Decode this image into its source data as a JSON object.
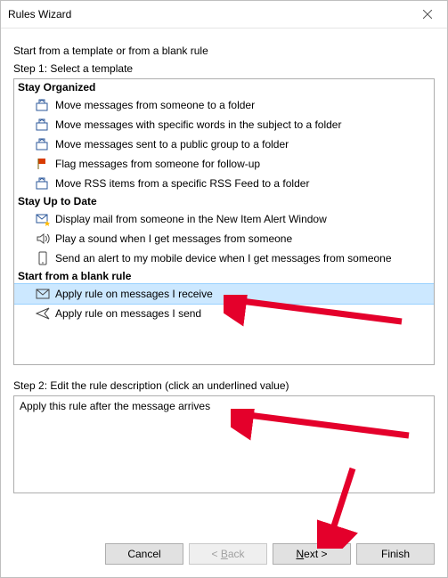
{
  "titlebar": {
    "title": "Rules Wizard"
  },
  "intro": "Start from a template or from a blank rule",
  "step1_label": "Step 1: Select a template",
  "categories": [
    {
      "name": "Stay Organized",
      "items": [
        {
          "icon": "move-folder-icon",
          "label": "Move messages from someone to a folder"
        },
        {
          "icon": "move-folder-icon",
          "label": "Move messages with specific words in the subject to a folder"
        },
        {
          "icon": "move-folder-icon",
          "label": "Move messages sent to a public group to a folder"
        },
        {
          "icon": "flag-icon",
          "label": "Flag messages from someone for follow-up"
        },
        {
          "icon": "move-folder-icon",
          "label": "Move RSS items from a specific RSS Feed to a folder"
        }
      ]
    },
    {
      "name": "Stay Up to Date",
      "items": [
        {
          "icon": "mail-star-icon",
          "label": "Display mail from someone in the New Item Alert Window"
        },
        {
          "icon": "sound-icon",
          "label": "Play a sound when I get messages from someone"
        },
        {
          "icon": "mobile-icon",
          "label": "Send an alert to my mobile device when I get messages from someone"
        }
      ]
    },
    {
      "name": "Start from a blank rule",
      "items": [
        {
          "icon": "envelope-icon",
          "label": "Apply rule on messages I receive",
          "selected": true
        },
        {
          "icon": "send-icon",
          "label": "Apply rule on messages I send"
        }
      ]
    }
  ],
  "step2_label": "Step 2: Edit the rule description (click an underlined value)",
  "step2_text": "Apply this rule after the message arrives",
  "buttons": {
    "cancel": "Cancel",
    "back_prefix": "< ",
    "back_underline": "B",
    "back_rest": "ack",
    "next_underline": "N",
    "next_rest": "ext >",
    "finish": "Finish"
  }
}
